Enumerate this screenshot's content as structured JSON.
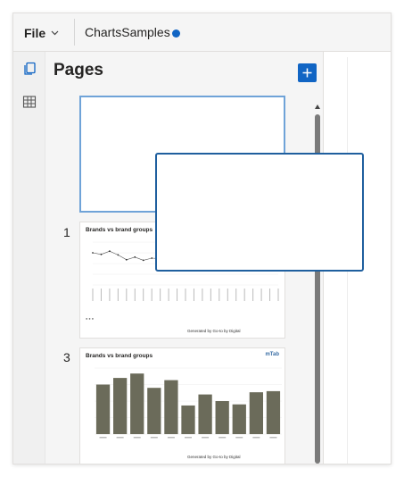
{
  "menu": {
    "file_label": "File"
  },
  "report": {
    "title": "ChartsSamples",
    "status_color": "#1165c4"
  },
  "rail": {
    "items": [
      {
        "icon": "pages-icon"
      },
      {
        "icon": "table-icon"
      }
    ]
  },
  "panel": {
    "title": "Pages",
    "add_icon": "plus-icon"
  },
  "pages": [
    {
      "number": "",
      "selected": true
    },
    {
      "number": "1",
      "title": "Brands vs brand groups",
      "footer": "Generated by Go-to by Digital",
      "chart_data": {
        "type": "line",
        "values": [
          60,
          57,
          63,
          56,
          47,
          52,
          46,
          50,
          49,
          50,
          47,
          46,
          48,
          47,
          47,
          48,
          46,
          48,
          47,
          46,
          47,
          48,
          49
        ]
      }
    },
    {
      "number": "3",
      "title": "Brands vs brand groups",
      "brand": "mTab",
      "footer": "Generated by Go-to by Digital",
      "chart_data": {
        "type": "bar",
        "values": [
          45,
          51,
          55,
          42,
          49,
          26,
          36,
          30,
          27,
          38,
          39
        ],
        "bar_color": "#6b6b5a"
      }
    }
  ],
  "accent_color": "#1165c4"
}
